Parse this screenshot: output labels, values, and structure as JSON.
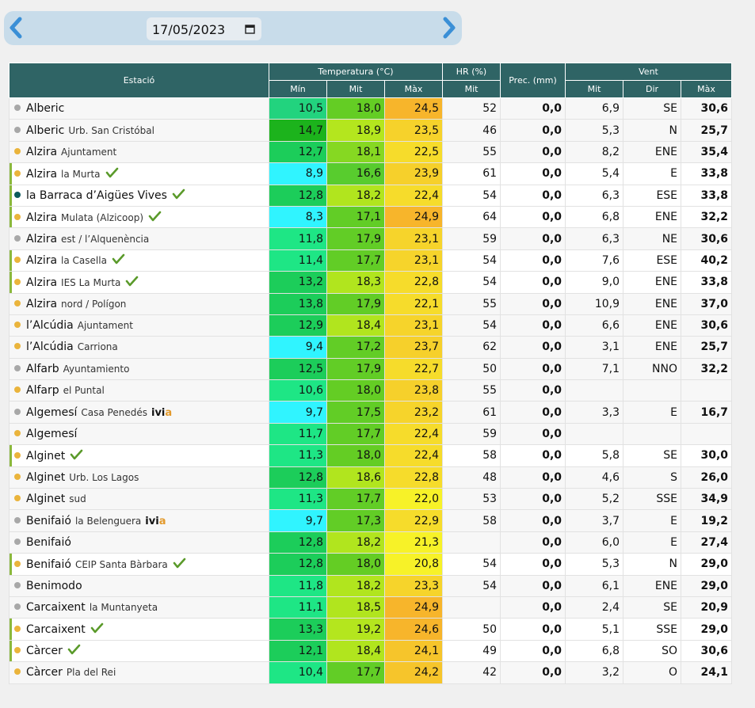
{
  "date_picker": {
    "value": "17/05/2023",
    "prev_icon": "chevron-left-icon",
    "next_icon": "chevron-right-icon",
    "calendar_icon": "calendar-icon"
  },
  "table": {
    "headers": {
      "station": "Estació",
      "temperature": "Temperatura (°C)",
      "hr": "HR (%)",
      "prec": "Prec. (mm)",
      "wind": "Vent",
      "min": "Mín",
      "mit": "Mit",
      "max": "Màx",
      "hr_mit": "Mit",
      "wind_mit": "Mit",
      "wind_dir": "Dir",
      "wind_max": "Màx"
    },
    "colors": {
      "header_bg": "#2f6465",
      "highlight_border": "#8bb83c",
      "check": "#5a9a2a"
    },
    "rows": [
      {
        "loc": "Alberic",
        "sub": "",
        "dot": "grey",
        "check": false,
        "hl": false,
        "min": "10,5",
        "mit": "18,0",
        "max": "24,5",
        "hr": "52",
        "prec": "0,0",
        "wmit": "6,9",
        "dir": "SE",
        "wmax": "30,6",
        "cmin": "#22d37e",
        "cmit": "#64cd24",
        "cmax": "#f7b52b"
      },
      {
        "loc": "Alberic",
        "sub": "Urb. San Cristóbal",
        "dot": "grey",
        "check": false,
        "hl": false,
        "min": "14,7",
        "mit": "18,9",
        "max": "23,5",
        "hr": "46",
        "prec": "0,0",
        "wmit": "5,3",
        "dir": "N",
        "wmax": "25,7",
        "cmin": "#1cb31c",
        "cmit": "#b4e61e",
        "cmax": "#f6d22b"
      },
      {
        "loc": "Alzira",
        "sub": "Ajuntament",
        "dot": "orange",
        "check": false,
        "hl": false,
        "min": "12,7",
        "mit": "18,1",
        "max": "22,5",
        "hr": "55",
        "prec": "0,0",
        "wmit": "8,2",
        "dir": "ENE",
        "wmax": "35,4",
        "cmin": "#1ccd5a",
        "cmit": "#86d822",
        "cmax": "#f6dc2b"
      },
      {
        "loc": "Alzira",
        "sub": "la Murta",
        "dot": "orange",
        "check": true,
        "hl": true,
        "min": "8,9",
        "mit": "16,6",
        "max": "23,9",
        "hr": "61",
        "prec": "0,0",
        "wmit": "5,4",
        "dir": "E",
        "wmax": "33,8",
        "cmin": "#30f4ff",
        "cmit": "#58cc2e",
        "cmax": "#f6d02b"
      },
      {
        "loc": "la Barraca d’Aigües Vives",
        "sub": "",
        "dot": "teal",
        "check": true,
        "hl": true,
        "min": "12,8",
        "mit": "18,2",
        "max": "22,4",
        "hr": "54",
        "prec": "0,0",
        "wmit": "6,3",
        "dir": "ESE",
        "wmax": "33,8",
        "cmin": "#1ccd5a",
        "cmit": "#b1e51e",
        "cmax": "#f6dc2b"
      },
      {
        "loc": "Alzira",
        "sub": "Mulata (Alzicoop)",
        "dot": "orange",
        "check": true,
        "hl": true,
        "min": "8,3",
        "mit": "17,1",
        "max": "24,9",
        "hr": "64",
        "prec": "0,0",
        "wmit": "6,8",
        "dir": "ENE",
        "wmax": "32,2",
        "cmin": "#30f4ff",
        "cmit": "#62cd26",
        "cmax": "#f7b52b"
      },
      {
        "loc": "Alzira",
        "sub": "est / l’Alquenència",
        "dot": "grey",
        "check": false,
        "hl": false,
        "min": "11,8",
        "mit": "17,9",
        "max": "23,1",
        "hr": "59",
        "prec": "0,0",
        "wmit": "6,3",
        "dir": "NE",
        "wmax": "30,6",
        "cmin": "#1ee685",
        "cmit": "#62cd26",
        "cmax": "#f6d42b"
      },
      {
        "loc": "Alzira",
        "sub": "la Casella",
        "dot": "orange",
        "check": true,
        "hl": true,
        "min": "11,4",
        "mit": "17,7",
        "max": "23,1",
        "hr": "54",
        "prec": "0,0",
        "wmit": "7,6",
        "dir": "ESE",
        "wmax": "40,2",
        "cmin": "#1ee685",
        "cmit": "#62cd26",
        "cmax": "#f6d42b"
      },
      {
        "loc": "Alzira",
        "sub": "IES La Murta",
        "dot": "orange",
        "check": true,
        "hl": true,
        "min": "13,2",
        "mit": "18,3",
        "max": "22,8",
        "hr": "54",
        "prec": "0,0",
        "wmit": "9,0",
        "dir": "ENE",
        "wmax": "33,8",
        "cmin": "#1ccd5a",
        "cmit": "#b1e51e",
        "cmax": "#f6dc2b"
      },
      {
        "loc": "Alzira",
        "sub": "nord / Polígon",
        "dot": "orange",
        "check": false,
        "hl": false,
        "min": "13,8",
        "mit": "17,9",
        "max": "22,1",
        "hr": "55",
        "prec": "0,0",
        "wmit": "10,9",
        "dir": "ENE",
        "wmax": "37,0",
        "cmin": "#1ccd5a",
        "cmit": "#62cd26",
        "cmax": "#f6dc2b"
      },
      {
        "loc": "l’Alcúdia",
        "sub": "Ajuntament",
        "dot": "orange",
        "check": false,
        "hl": false,
        "min": "12,9",
        "mit": "18,4",
        "max": "23,1",
        "hr": "54",
        "prec": "0,0",
        "wmit": "6,6",
        "dir": "ENE",
        "wmax": "30,6",
        "cmin": "#1ccd5a",
        "cmit": "#b1e51e",
        "cmax": "#f6d42b"
      },
      {
        "loc": "l’Alcúdia",
        "sub": "Carriona",
        "dot": "orange",
        "check": false,
        "hl": false,
        "min": "9,4",
        "mit": "17,2",
        "max": "23,7",
        "hr": "62",
        "prec": "0,0",
        "wmit": "3,1",
        "dir": "ENE",
        "wmax": "25,7",
        "cmin": "#30f4ff",
        "cmit": "#62cd26",
        "cmax": "#f6d02b"
      },
      {
        "loc": "Alfarb",
        "sub": "Ayuntamiento",
        "dot": "grey",
        "check": false,
        "hl": false,
        "min": "12,5",
        "mit": "17,9",
        "max": "22,7",
        "hr": "50",
        "prec": "0,0",
        "wmit": "7,1",
        "dir": "NNO",
        "wmax": "32,2",
        "cmin": "#1ccd5a",
        "cmit": "#62cd26",
        "cmax": "#f6dc2b"
      },
      {
        "loc": "Alfarp",
        "sub": "el Puntal",
        "dot": "orange",
        "check": false,
        "hl": false,
        "min": "10,6",
        "mit": "18,0",
        "max": "23,8",
        "hr": "55",
        "prec": "0,0",
        "wmit": "",
        "dir": "",
        "wmax": "",
        "cmin": "#1ee685",
        "cmit": "#64cd24",
        "cmax": "#f6d02b"
      },
      {
        "loc": "Algemesí",
        "sub": "Casa Penedés",
        "ivia": true,
        "dot": "grey",
        "check": false,
        "hl": false,
        "min": "9,7",
        "mit": "17,5",
        "max": "23,2",
        "hr": "61",
        "prec": "0,0",
        "wmit": "3,3",
        "dir": "E",
        "wmax": "16,7",
        "cmin": "#30f4ff",
        "cmit": "#62cd26",
        "cmax": "#f6d42b"
      },
      {
        "loc": "Algemesí",
        "sub": "",
        "dot": "orange",
        "check": false,
        "hl": false,
        "min": "11,7",
        "mit": "17,7",
        "max": "22,4",
        "hr": "59",
        "prec": "0,0",
        "wmit": "",
        "dir": "",
        "wmax": "",
        "cmin": "#1ee685",
        "cmit": "#62cd26",
        "cmax": "#f6dc2b"
      },
      {
        "loc": "Alginet",
        "sub": "",
        "dot": "orange",
        "check": true,
        "hl": true,
        "min": "11,3",
        "mit": "18,0",
        "max": "22,4",
        "hr": "58",
        "prec": "0,0",
        "wmit": "5,8",
        "dir": "SE",
        "wmax": "30,0",
        "cmin": "#1ee685",
        "cmit": "#64cd24",
        "cmax": "#f6dc2b"
      },
      {
        "loc": "Alginet",
        "sub": "Urb. Los Lagos",
        "dot": "orange",
        "check": false,
        "hl": false,
        "min": "12,8",
        "mit": "18,6",
        "max": "22,8",
        "hr": "48",
        "prec": "0,0",
        "wmit": "4,6",
        "dir": "S",
        "wmax": "26,0",
        "cmin": "#1ccd5a",
        "cmit": "#b1e51e",
        "cmax": "#f6dc2b"
      },
      {
        "loc": "Alginet",
        "sub": "sud",
        "dot": "orange",
        "check": false,
        "hl": false,
        "min": "11,3",
        "mit": "17,7",
        "max": "22,0",
        "hr": "53",
        "prec": "0,0",
        "wmit": "5,2",
        "dir": "SSE",
        "wmax": "34,9",
        "cmin": "#1ee685",
        "cmit": "#62cd26",
        "cmax": "#f7f228"
      },
      {
        "loc": "Benifaió",
        "sub": "la Belenguera",
        "ivia": true,
        "dot": "grey",
        "check": false,
        "hl": false,
        "min": "9,7",
        "mit": "17,3",
        "max": "22,9",
        "hr": "58",
        "prec": "0,0",
        "wmit": "3,7",
        "dir": "E",
        "wmax": "19,2",
        "cmin": "#30f4ff",
        "cmit": "#62cd26",
        "cmax": "#f6dc2b"
      },
      {
        "loc": "Benifaió",
        "sub": "",
        "dot": "grey",
        "check": false,
        "hl": false,
        "min": "12,8",
        "mit": "18,2",
        "max": "21,3",
        "hr": "",
        "prec": "0,0",
        "wmit": "6,0",
        "dir": "E",
        "wmax": "27,4",
        "cmin": "#1ccd5a",
        "cmit": "#b1e51e",
        "cmax": "#f7f228"
      },
      {
        "loc": "Benifaió",
        "sub": "CEIP Santa Bàrbara",
        "dot": "orange",
        "check": true,
        "hl": true,
        "min": "12,8",
        "mit": "18,0",
        "max": "20,8",
        "hr": "54",
        "prec": "0,0",
        "wmit": "5,3",
        "dir": "N",
        "wmax": "29,0",
        "cmin": "#1ccd5a",
        "cmit": "#64cd24",
        "cmax": "#f7f228"
      },
      {
        "loc": "Benimodo",
        "sub": "",
        "dot": "grey",
        "check": false,
        "hl": false,
        "min": "11,8",
        "mit": "18,2",
        "max": "23,3",
        "hr": "54",
        "prec": "0,0",
        "wmit": "6,1",
        "dir": "ENE",
        "wmax": "29,0",
        "cmin": "#1ee685",
        "cmit": "#b1e51e",
        "cmax": "#f6d42b"
      },
      {
        "loc": "Carcaixent",
        "sub": "la Muntanyeta",
        "dot": "grey",
        "check": false,
        "hl": false,
        "min": "11,1",
        "mit": "18,5",
        "max": "24,9",
        "hr": "",
        "prec": "0,0",
        "wmit": "2,4",
        "dir": "SE",
        "wmax": "20,9",
        "cmin": "#1ee685",
        "cmit": "#b1e51e",
        "cmax": "#f7b52b"
      },
      {
        "loc": "Carcaixent",
        "sub": "",
        "dot": "orange",
        "check": true,
        "hl": true,
        "min": "13,3",
        "mit": "19,2",
        "max": "24,6",
        "hr": "50",
        "prec": "0,0",
        "wmit": "5,1",
        "dir": "SSE",
        "wmax": "29,0",
        "cmin": "#1ccd5a",
        "cmit": "#b4e61e",
        "cmax": "#f7b52b"
      },
      {
        "loc": "Càrcer",
        "sub": "",
        "dot": "orange",
        "check": true,
        "hl": true,
        "min": "12,1",
        "mit": "18,4",
        "max": "24,1",
        "hr": "49",
        "prec": "0,0",
        "wmit": "6,8",
        "dir": "SO",
        "wmax": "30,6",
        "cmin": "#1ccd5a",
        "cmit": "#b1e51e",
        "cmax": "#f6c52b"
      },
      {
        "loc": "Càrcer",
        "sub": "Pla del Rei",
        "dot": "orange",
        "check": false,
        "hl": false,
        "min": "10,4",
        "mit": "17,7",
        "max": "24,2",
        "hr": "42",
        "prec": "0,0",
        "wmit": "3,2",
        "dir": "O",
        "wmax": "24,1",
        "cmin": "#1ee685",
        "cmit": "#62cd26",
        "cmax": "#f6c52b"
      }
    ]
  }
}
